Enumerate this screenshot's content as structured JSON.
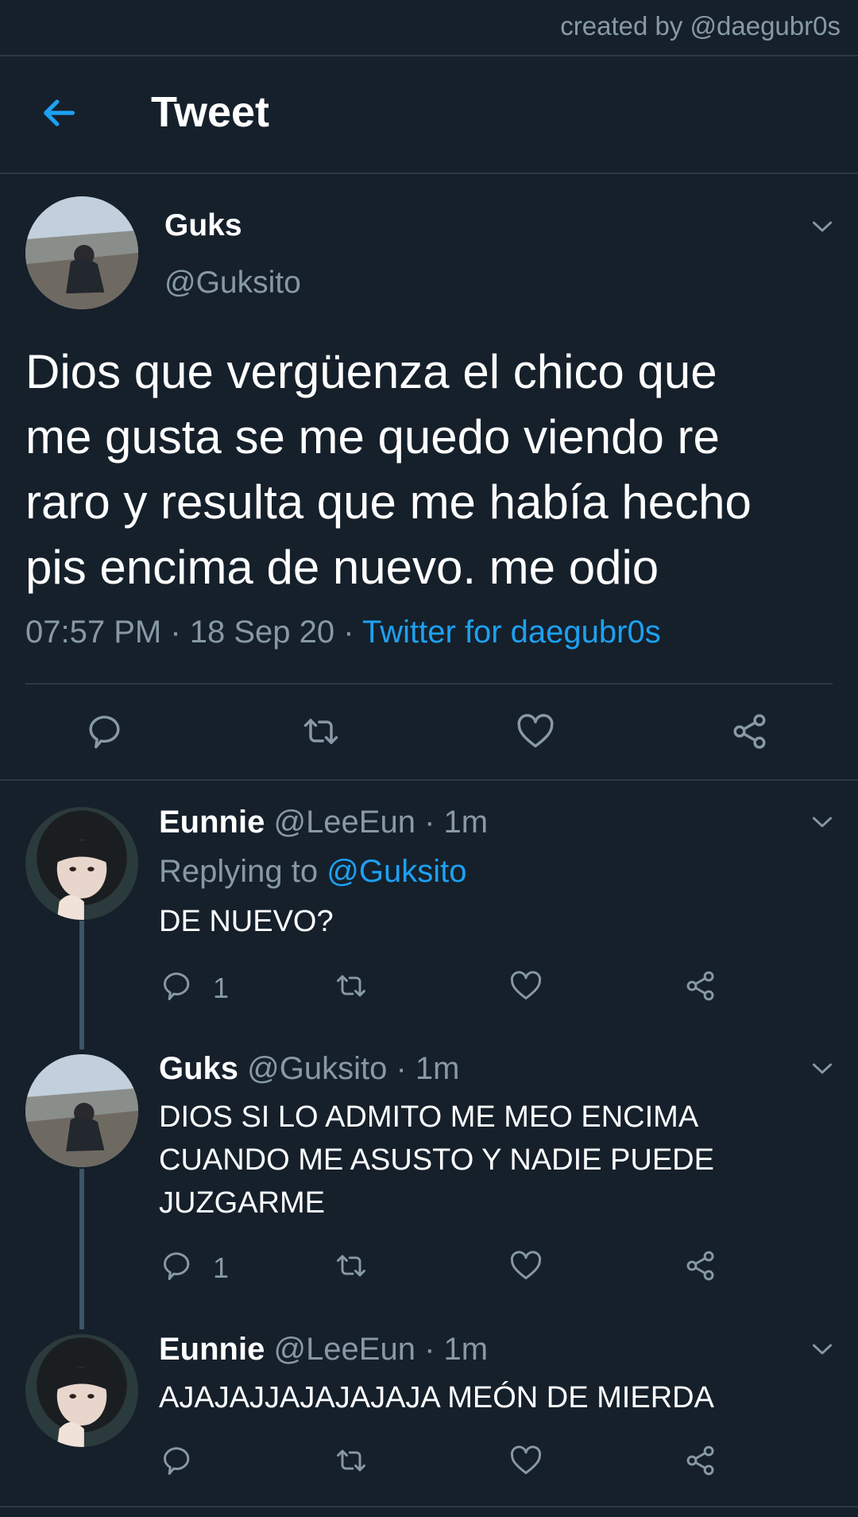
{
  "credit": "created by @daegubr0s",
  "header": {
    "title": "Tweet"
  },
  "main_tweet": {
    "name": "Guks",
    "handle": "@Guksito",
    "text": "Dios que vergüenza el chico que\nme gusta se me quedo viendo re\nraro y resulta que me había hecho\npis encima de nuevo. me odio",
    "time": "07:57 PM",
    "sep": " · ",
    "date": "18 Sep 20",
    "source": "Twitter for daegubr0s"
  },
  "replies": [
    {
      "name": "Eunnie",
      "meta": " @LeeEun · 1m",
      "replying_prefix": "Replying to ",
      "replying_to": "@Guksito",
      "text": "DE NUEVO?",
      "reply_count": "1"
    },
    {
      "name": "Guks",
      "meta": " @Guksito · 1m",
      "text": "DIOS SI LO ADMITO ME MEO ENCIMA\nCUANDO ME ASUSTO Y NADIE PUEDE\nJUZGARME",
      "reply_count": "1"
    },
    {
      "name": "Eunnie",
      "meta": " @LeeEun · 1m",
      "text": "AJAJAJJAJAJAJAJA MEÓN DE MIERDA",
      "reply_count": ""
    }
  ],
  "colors": {
    "background": "#15202b",
    "accent": "#1da1f2",
    "muted": "#8899a6",
    "divider": "#2c3944"
  },
  "icons": [
    "back-arrow-icon",
    "chevron-down-icon",
    "reply-icon",
    "retweet-icon",
    "like-icon",
    "share-icon"
  ]
}
